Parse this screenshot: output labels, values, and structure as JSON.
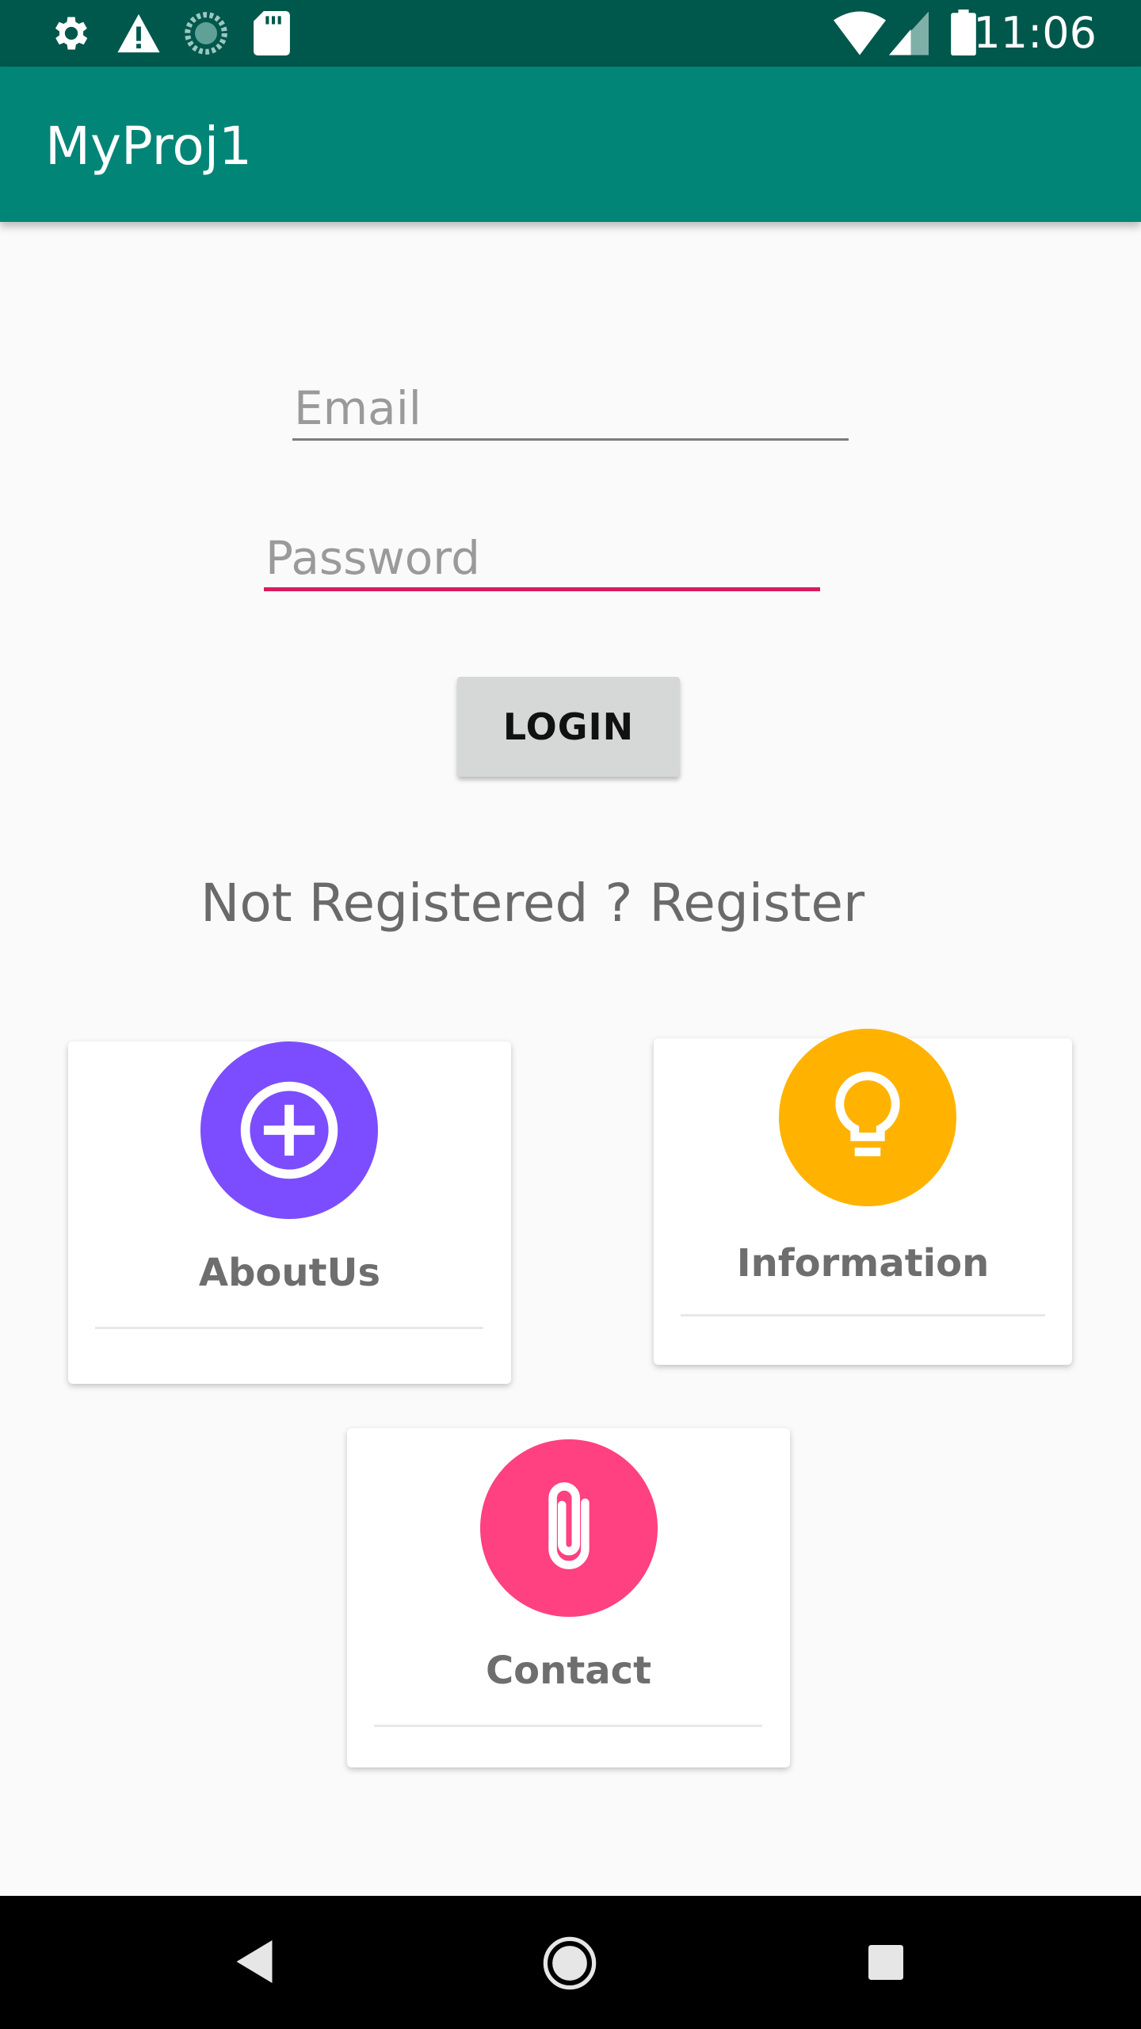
{
  "status_bar": {
    "time": "11:06",
    "left_icons": [
      "settings-icon",
      "warning-icon",
      "sync-icon",
      "sd-card-icon"
    ],
    "right_icons": [
      "wifi-icon",
      "signal-icon",
      "battery-icon"
    ]
  },
  "app_bar": {
    "title": "MyProj1"
  },
  "login_form": {
    "email_placeholder": "Email",
    "password_placeholder": "Password",
    "login_label": "LOGIN",
    "register_text": "Not Registered ? Register"
  },
  "cards": [
    {
      "label": "AboutUs",
      "icon": "add-circle-icon",
      "color": "#7C4DFF"
    },
    {
      "label": "Information",
      "icon": "lightbulb-icon",
      "color": "#FFB300"
    },
    {
      "label": "Contact",
      "icon": "paperclip-icon",
      "color": "#FF4081"
    }
  ],
  "nav_bar": {
    "icons": [
      "back-icon",
      "home-icon",
      "recents-icon"
    ]
  },
  "colors": {
    "status_bar": "#00574B",
    "primary": "#008577",
    "accent": "#D81B60",
    "background": "#FAFAFA"
  }
}
